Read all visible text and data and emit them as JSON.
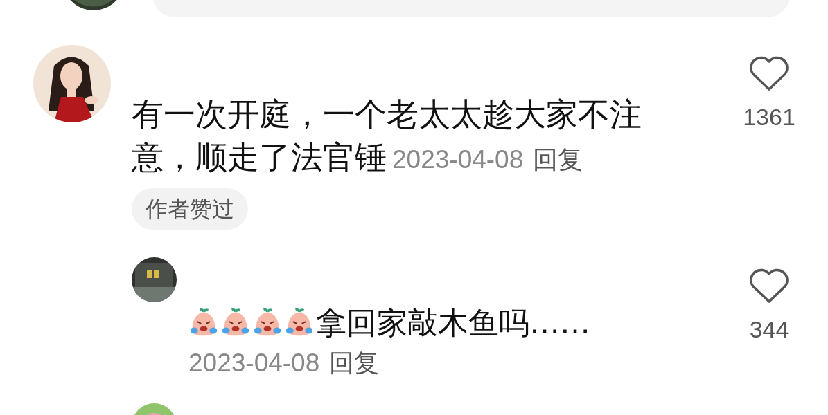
{
  "comments": [
    {
      "avatar": {
        "kind": "picture"
      },
      "text_lines": [
        "有一次开庭，一个老太太趁大家不注",
        "意，顺走了法官锤"
      ],
      "date": "2023-04-08",
      "reply_label": "回复",
      "tag": "作者赞过",
      "likes": "1361",
      "replies": [
        {
          "avatar": {
            "kind": "picture"
          },
          "emojis": [
            {
              "kind": "crying"
            },
            {
              "kind": "crying"
            },
            {
              "kind": "crying"
            },
            {
              "kind": "crying"
            }
          ],
          "text": "拿回家敲木鱼吗……",
          "date": "2023-04-08",
          "reply_label": "回复",
          "likes": "344"
        }
      ]
    }
  ]
}
